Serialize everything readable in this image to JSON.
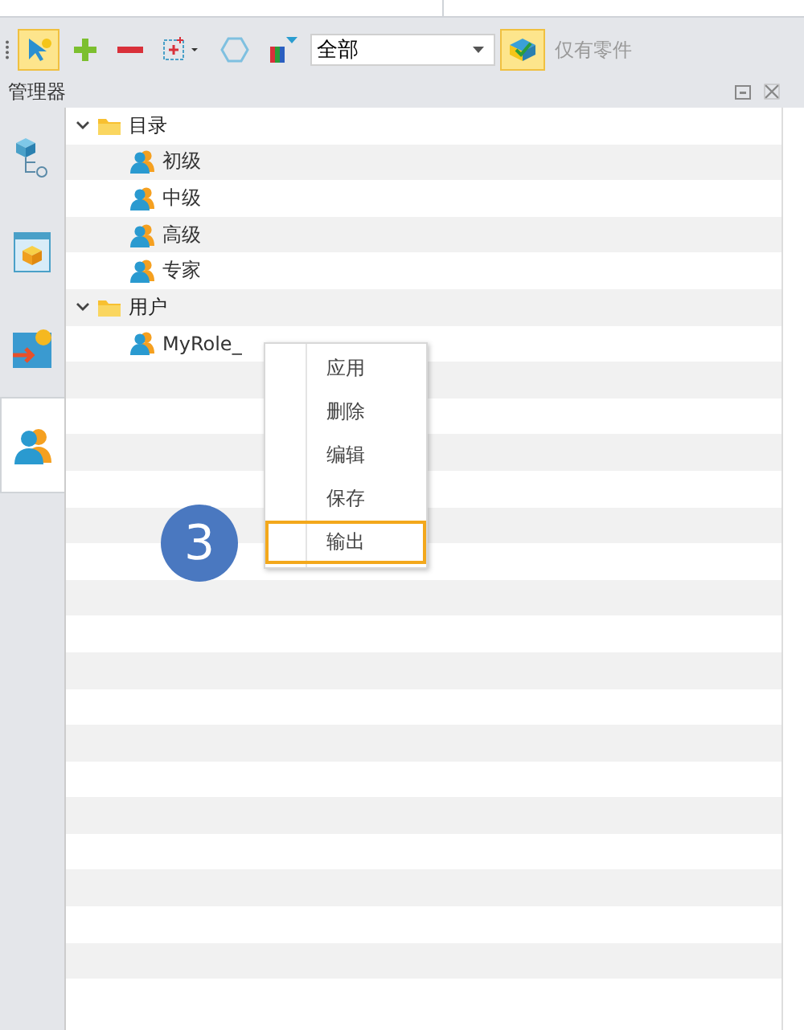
{
  "toolbar": {
    "tools": [
      {
        "kind": "select",
        "selected": true
      },
      {
        "kind": "add",
        "selected": false
      },
      {
        "kind": "remove",
        "selected": false
      },
      {
        "kind": "frame",
        "selected": false
      },
      {
        "kind": "hexagon",
        "selected": false
      },
      {
        "kind": "filter",
        "selected": false
      }
    ],
    "filter": {
      "value": "全部"
    },
    "parts_only": {
      "label": "仅有零件",
      "on": true
    }
  },
  "panel": {
    "title": "管理器"
  },
  "side_tabs": [
    {
      "kind": "hierarchy",
      "selected": false
    },
    {
      "kind": "cube",
      "selected": false
    },
    {
      "kind": "import",
      "selected": false
    },
    {
      "kind": "users",
      "selected": true
    }
  ],
  "tree": [
    {
      "label": "目录",
      "kind": "folder",
      "expanded": true,
      "children": [
        {
          "label": "初级",
          "kind": "role"
        },
        {
          "label": "中级",
          "kind": "role"
        },
        {
          "label": "高级",
          "kind": "role"
        },
        {
          "label": "专家",
          "kind": "role"
        }
      ]
    },
    {
      "label": "用户",
      "kind": "folder",
      "expanded": true,
      "children": [
        {
          "label": "MyRole_",
          "kind": "role"
        }
      ]
    }
  ],
  "context_menu": [
    {
      "label": "应用",
      "selected": false
    },
    {
      "label": "删除",
      "selected": false
    },
    {
      "label": "编辑",
      "selected": false
    },
    {
      "label": "保存",
      "selected": false
    },
    {
      "label": "输出",
      "selected": true
    }
  ],
  "step_badge": "3"
}
